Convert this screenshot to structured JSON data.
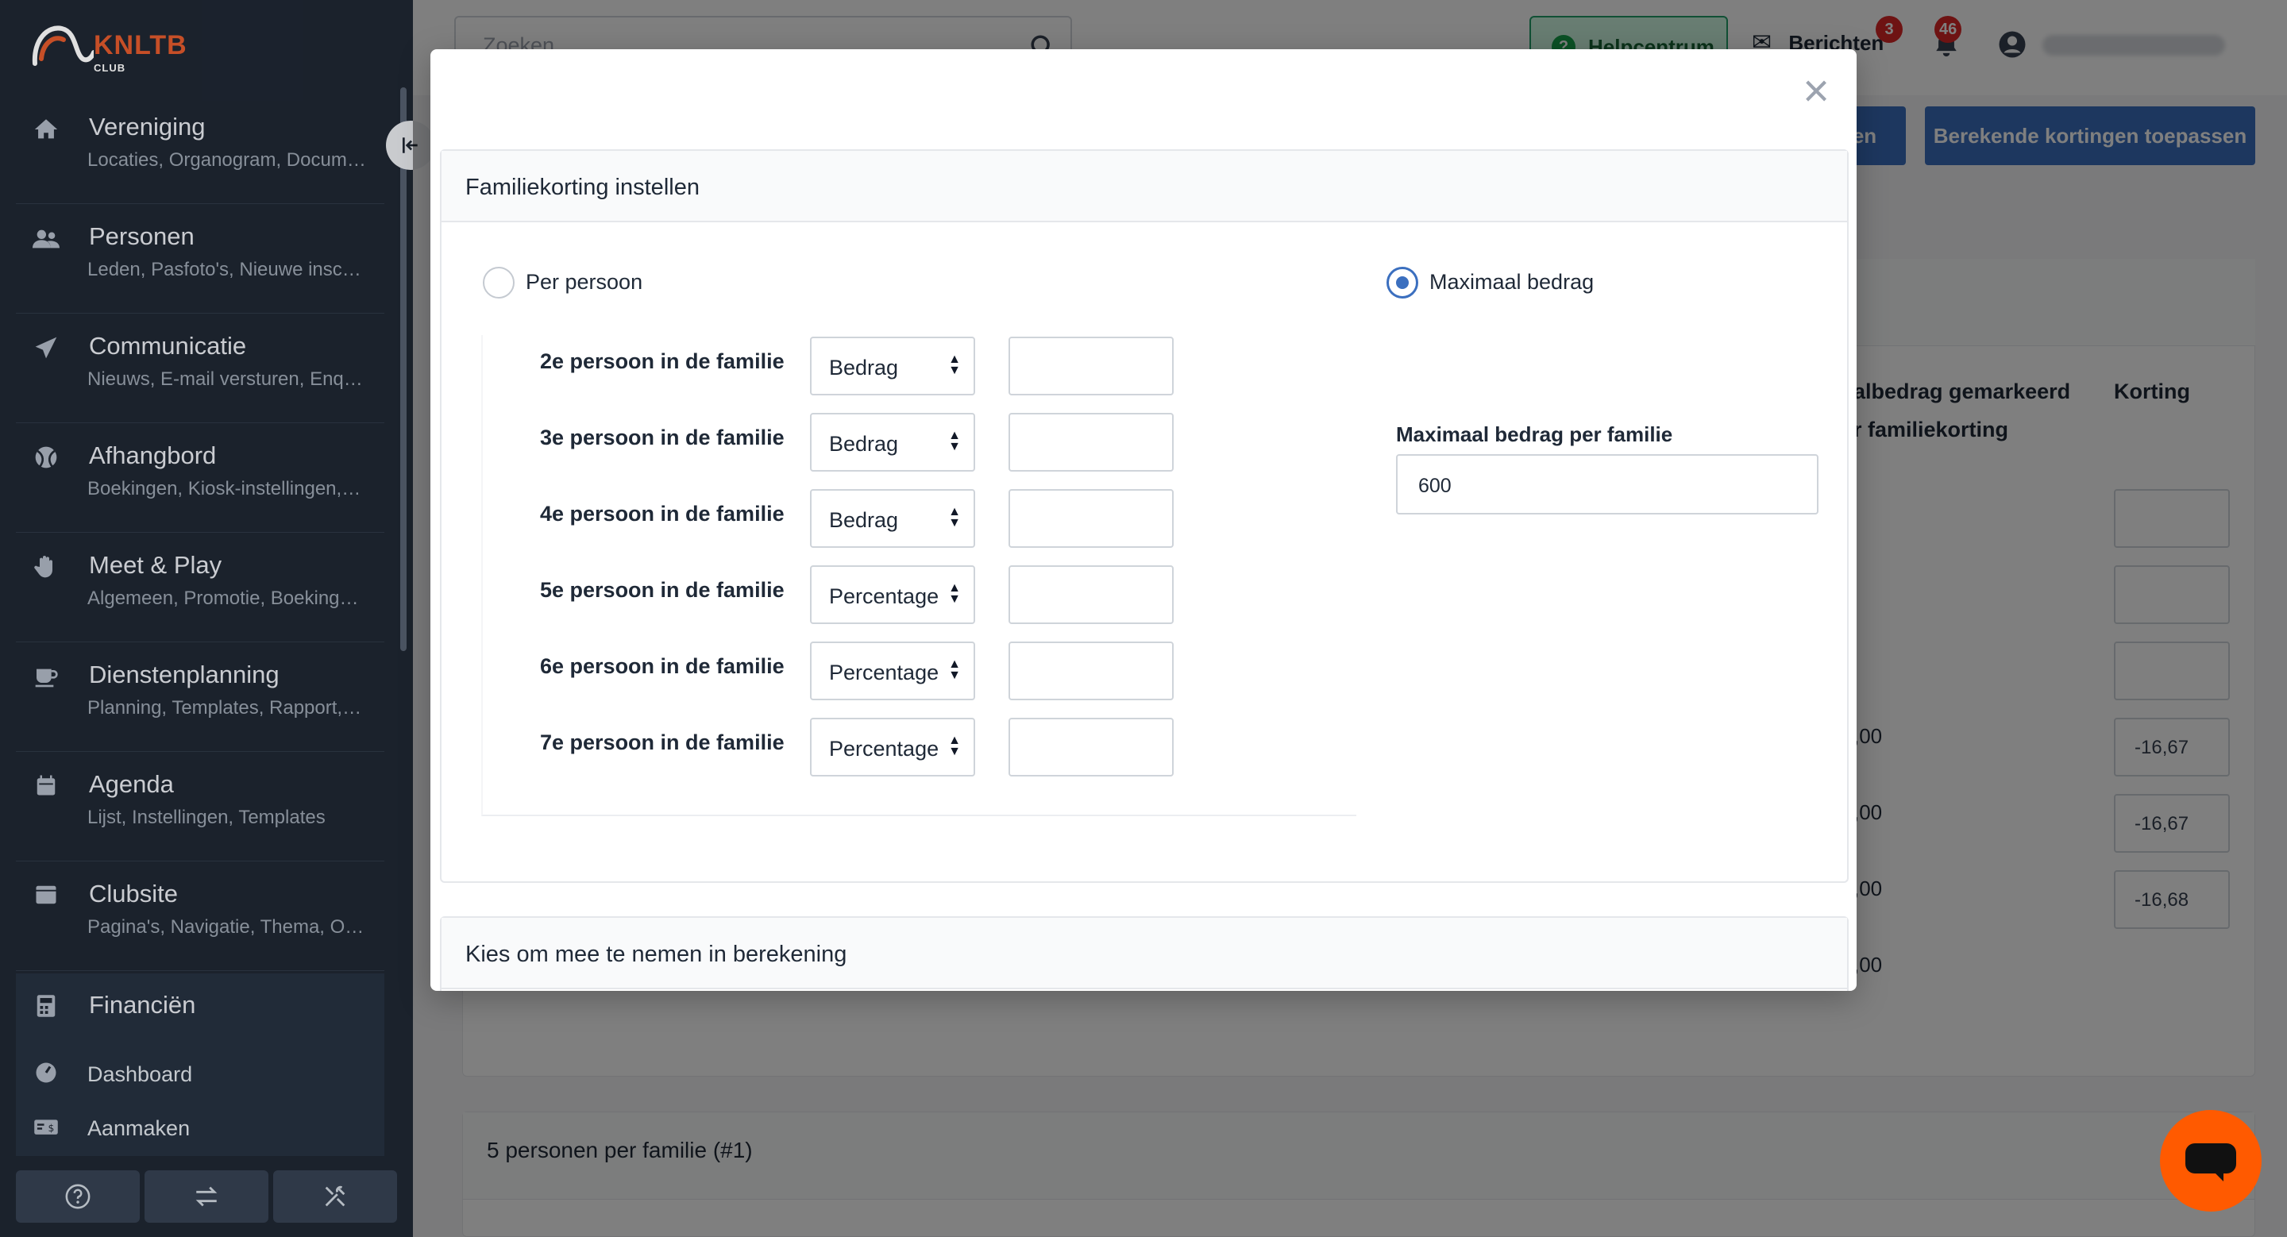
{
  "sidebar": {
    "logo": {
      "name": "KNLTB",
      "sub": "CLUB"
    },
    "items": [
      {
        "title": "Vereniging",
        "sub": "Locaties, Organogram, Docum…",
        "icon": "home-icon"
      },
      {
        "title": "Personen",
        "sub": "Leden, Pasfoto's, Nieuwe insc…",
        "icon": "users-icon"
      },
      {
        "title": "Communicatie",
        "sub": "Nieuws, E-mail versturen, Enq…",
        "icon": "send-icon"
      },
      {
        "title": "Afhangbord",
        "sub": "Boekingen, Kiosk-instellingen,…",
        "icon": "ball-icon"
      },
      {
        "title": "Meet & Play",
        "sub": "Algemeen, Promotie, Boeking…",
        "icon": "hand-icon"
      },
      {
        "title": "Dienstenplanning",
        "sub": "Planning, Templates, Rapport,…",
        "icon": "coffee-icon"
      },
      {
        "title": "Agenda",
        "sub": "Lijst, Instellingen, Templates",
        "icon": "calendar-icon"
      },
      {
        "title": "Clubsite",
        "sub": "Pagina's, Navigatie, Thema, O…",
        "icon": "browser-icon"
      },
      {
        "title": "Financiën",
        "sub": "",
        "icon": "calculator-icon"
      }
    ],
    "submenu": [
      {
        "label": "Dashboard",
        "icon": "gauge-icon"
      },
      {
        "label": "Aanmaken",
        "icon": "money-icon"
      }
    ]
  },
  "topbar": {
    "search_placeholder": "Zoeken",
    "help_label": "Helpcentrum",
    "messages_label": "Berichten",
    "messages_count": "3",
    "notifications_count": "46"
  },
  "background": {
    "button_partial": "en",
    "apply_button": "Berekende kortingen toepassen",
    "col_max_line1": "albedrag gemarkeerd",
    "col_max_line2": "r familiekorting",
    "col_discount": "Korting",
    "amounts": [
      ",00",
      ",00",
      ",00",
      ",00"
    ],
    "discounts": [
      "-16,67",
      "-16,67",
      "-16,68"
    ],
    "card2_title": "5 personen per familie (#1)"
  },
  "modal": {
    "panel_title": "Familiekorting instellen",
    "option_per_person": "Per persoon",
    "option_max": "Maximaal bedrag",
    "max_field_label": "Maximaal bedrag per familie",
    "max_field_value": "600",
    "rows": [
      {
        "label": "2e persoon in de familie",
        "type": "Bedrag",
        "value": ""
      },
      {
        "label": "3e persoon in de familie",
        "type": "Bedrag",
        "value": ""
      },
      {
        "label": "4e persoon in de familie",
        "type": "Bedrag",
        "value": ""
      },
      {
        "label": "5e persoon in de familie",
        "type": "Percentage",
        "value": ""
      },
      {
        "label": "6e persoon in de familie",
        "type": "Percentage",
        "value": ""
      },
      {
        "label": "7e persoon in de familie",
        "type": "Percentage",
        "value": ""
      }
    ],
    "panel2_title": "Kies om mee te nemen in berekening"
  },
  "colors": {
    "sidebar_bg": "#1f2733",
    "accent_blue": "#3b6fbf",
    "brand_orange": "#e25a2d",
    "chat_orange": "#ff5a00",
    "badge_red": "#dc2626"
  }
}
